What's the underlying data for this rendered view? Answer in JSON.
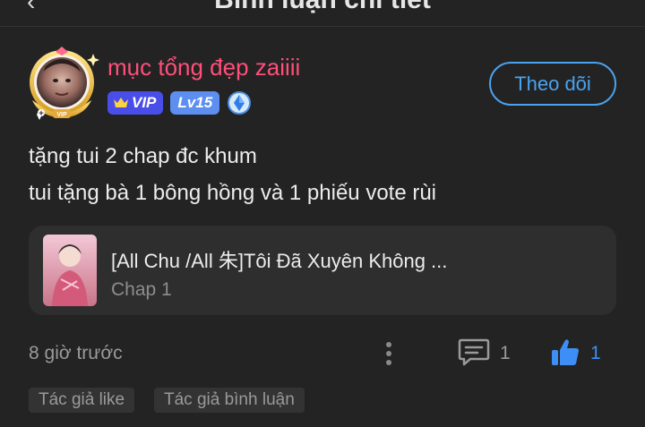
{
  "header": {
    "title": "Bình luận chi tiết",
    "back_icon": "back-arrow-icon"
  },
  "user": {
    "name": "mục tổng đẹp zaiiii",
    "avatar_frame_label": "VIP",
    "vip_label": "VIP",
    "level_label": "Lv15",
    "follow_label": "Theo dõi"
  },
  "comment": {
    "line1": "tặng tui 2 chap đc khum",
    "line2": "tui tặng bà 1 bông hồng và 1 phiếu vote rùi"
  },
  "linked_story": {
    "title": "[All Chu /All 朱]Tôi Đã Xuyên Không ...",
    "chapter": "Chap 1"
  },
  "footer": {
    "time": "8 giờ trước",
    "comment_count": "1",
    "like_count": "1"
  },
  "tags": [
    "Tác giả like",
    "Tác giả bình luận"
  ],
  "colors": {
    "background": "#232323",
    "username": "#ff4f7a",
    "accent": "#4aa3f0",
    "like": "#3d8ff5",
    "vip_badge": "#4a4ee8",
    "level_badge": "#5d8ff0"
  }
}
